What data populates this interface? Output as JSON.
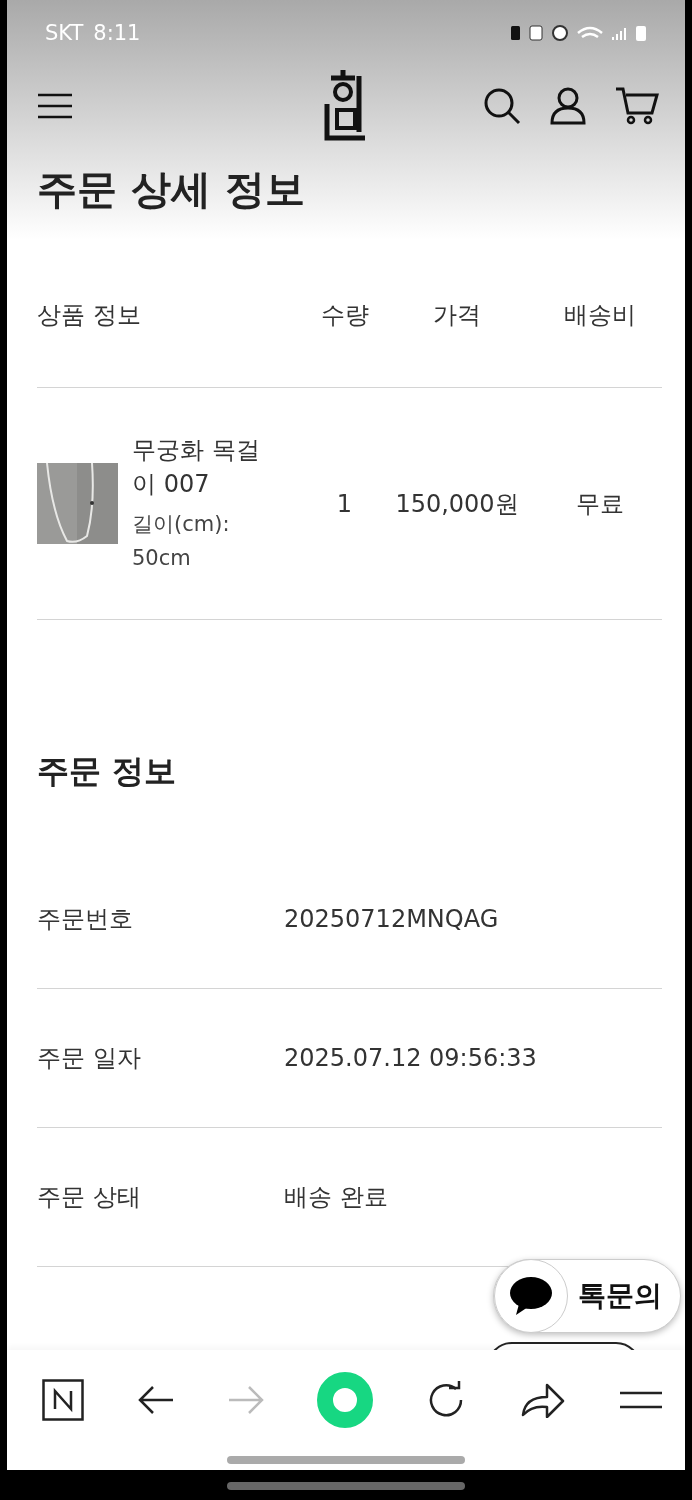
{
  "status_bar": {
    "carrier": "SKT",
    "time": "8:11"
  },
  "title": "주문 상세 정보",
  "product_table": {
    "columns": [
      "상품 정보",
      "수량",
      "가격",
      "배송비"
    ],
    "rows": [
      {
        "name": "무궁화 목걸이 007",
        "option": "길이(cm): 50cm",
        "quantity": "1",
        "price": "150,000원",
        "shipping": "무료"
      }
    ]
  },
  "order_info": {
    "title": "주문 정보",
    "rows": [
      {
        "label": "주문번호",
        "value": "20250712MNQAG"
      },
      {
        "label": "주문 일자",
        "value": "2025.07.12 09:56:33"
      },
      {
        "label": "주문 상태",
        "value": "배송 완료"
      }
    ]
  },
  "chat_button": {
    "label": "톡문의"
  },
  "browser_bar": {
    "forward_disabled": true
  }
}
